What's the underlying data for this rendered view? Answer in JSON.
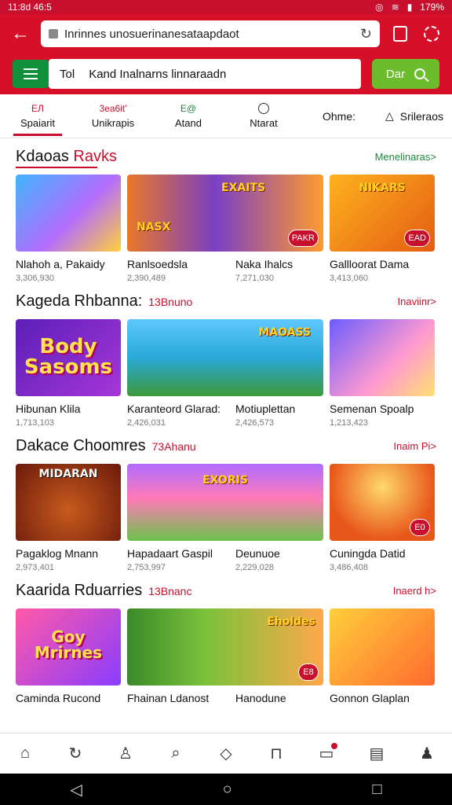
{
  "status_bar": {
    "time": "11:8d 46:5",
    "battery": "179%"
  },
  "browser": {
    "url": "Inrinnes unosuerinanesataapdaot"
  },
  "search": {
    "prefix": "Tol",
    "query": "Kand Inalnarns linnaraadn",
    "button_label": "Dar"
  },
  "tabs": [
    {
      "glyph": "ЕЛ",
      "label": "Spaiarit"
    },
    {
      "glyph": "3ea6it'",
      "label": "Unikrapis"
    },
    {
      "glyph": "E@",
      "label": "Atand"
    },
    {
      "glyph": "",
      "label": "Ntarat"
    },
    {
      "glyph": "",
      "label": "Ohme:"
    },
    {
      "glyph": "",
      "label": "Srileraos"
    }
  ],
  "sections": [
    {
      "title_main": "Kdaoas ",
      "title_accent": "Ravks",
      "count": "",
      "more": "Menelinaras>",
      "cards": [
        {
          "name": "Nlahoh a, Pakaidy",
          "sub": "3,306,930",
          "tag": "",
          "art": ""
        },
        {
          "name": "Ranlsoedsla",
          "sub": "2,390,489",
          "tag": "",
          "art": "NASX"
        },
        {
          "name": "Naka Ihalcs",
          "sub": "7,271,030",
          "tag": "PAKR",
          "art": "EXAITS"
        },
        {
          "name": "Gallloorat Dama",
          "sub": "3,413,060",
          "tag": "EAD",
          "art": "NIKARS"
        }
      ]
    },
    {
      "title_main": "Kageda Rhbanna:",
      "title_accent": "",
      "count": "13Bnuno",
      "more": "Inaviinr>",
      "cards": [
        {
          "name": "Hibunan Klila",
          "sub": "1,713,103",
          "tag": "",
          "art": "Body Sasoms"
        },
        {
          "name": "Karanteord Glarad:",
          "sub": "2,426,031",
          "tag": "",
          "art": "MAOASS"
        },
        {
          "name": "Motiuplettan",
          "sub": "2,426,573",
          "tag": "",
          "art": ""
        },
        {
          "name": "Semenan Spoalp",
          "sub": "1,213,423",
          "tag": "",
          "art": ""
        }
      ]
    },
    {
      "title_main": "Dakace Choomres",
      "title_accent": "",
      "count": "73Ahanu",
      "more": "Inaim Pi>",
      "cards": [
        {
          "name": "Pagaklog Mnann",
          "sub": "2,973,401",
          "tag": "",
          "art": "MIDARAN"
        },
        {
          "name": "Hapadaart Gaspil",
          "sub": "2,753,997",
          "tag": "",
          "art": "EXORIS"
        },
        {
          "name": "Deunuoe",
          "sub": "2,229,028",
          "tag": "",
          "art": ""
        },
        {
          "name": "Cuningda Datid",
          "sub": "3,486,408",
          "tag": "E0",
          "art": ""
        }
      ]
    },
    {
      "title_main": "Kaarida Rduarries",
      "title_accent": "",
      "count": "13Bnanc",
      "more": "Inaerd h>",
      "cards": [
        {
          "name": "Caminda Rucond",
          "sub": "",
          "tag": "",
          "art": "Goy Mrirnes"
        },
        {
          "name": "Fhainan Ldanost",
          "sub": "",
          "tag": "",
          "art": ""
        },
        {
          "name": "Hanodune",
          "sub": "",
          "tag": "",
          "art": ""
        },
        {
          "name": "Gonnon Glaplan",
          "sub": "",
          "tag": "E8",
          "art": "Eholdes"
        }
      ]
    }
  ],
  "colors": {
    "brand": "#c8102e",
    "accent_green": "#6cbd2c",
    "menu_green": "#10903a"
  }
}
